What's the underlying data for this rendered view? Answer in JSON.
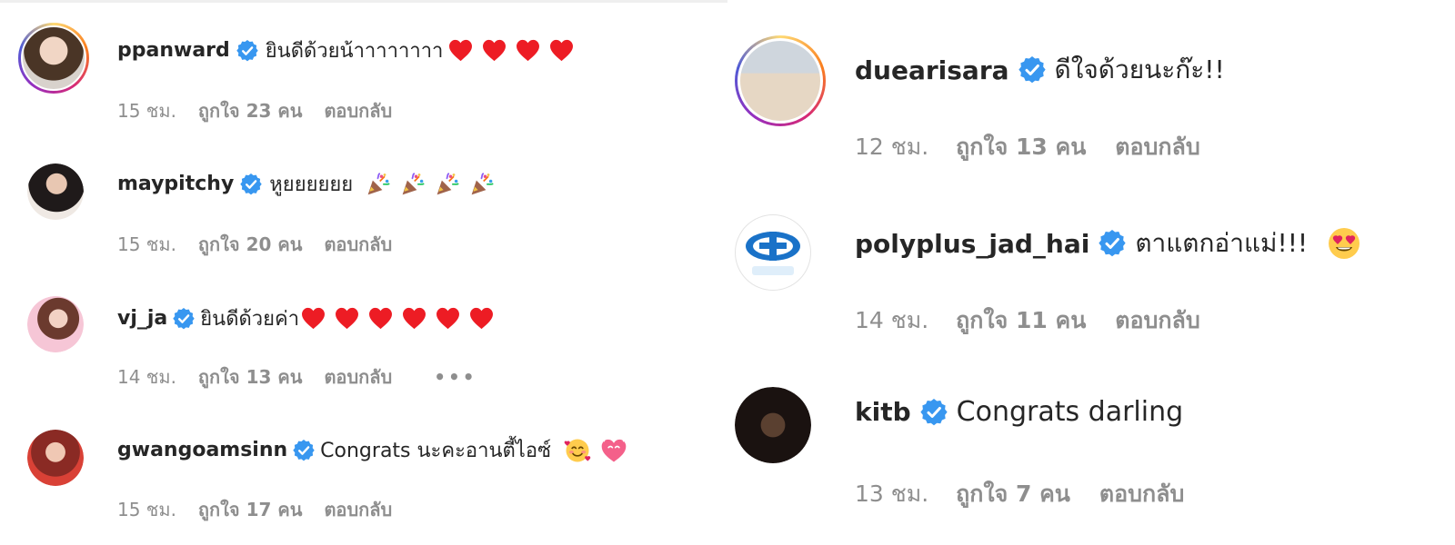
{
  "left": {
    "comments": [
      {
        "username": "ppanward",
        "text": "ยินดีด้วยน้าาาาาาาา",
        "emojis": [
          "heart",
          "heart",
          "heart",
          "heart"
        ],
        "time": "15 ชม.",
        "likes": "ถูกใจ 23 คน",
        "reply": "ตอบกลับ"
      },
      {
        "username": "maypitchy",
        "text": "หูยยยยยย",
        "emojis": [
          "party",
          "party",
          "party",
          "party"
        ],
        "time": "15 ชม.",
        "likes": "ถูกใจ 20 คน",
        "reply": "ตอบกลับ"
      },
      {
        "username": "vj_ja",
        "text": "ยินดีด้วยค่า",
        "emojis": [
          "heart",
          "heart",
          "heart",
          "heart",
          "heart",
          "heart"
        ],
        "time": "14 ชม.",
        "likes": "ถูกใจ 13 คน",
        "reply": "ตอบกลับ",
        "more": "•••"
      },
      {
        "username": "gwangoamsinn",
        "text": "Congrats นะคะอานตี้ไอซ์",
        "emojis": [
          "smiling-hearts",
          "heart-eyes-pink"
        ],
        "time": "15 ชม.",
        "likes": "ถูกใจ 17 คน",
        "reply": "ตอบกลับ"
      }
    ]
  },
  "right": {
    "comments": [
      {
        "username": "duearisara",
        "text": "ดีใจด้วยนะก๊ะ!!",
        "emojis": [],
        "time": "12 ชม.",
        "likes": "ถูกใจ 13 คน",
        "reply": "ตอบกลับ"
      },
      {
        "username": "polyplus_jad_hai",
        "text": "ตาแตกอ่าแม่!!!",
        "emojis": [
          "heart-eyes"
        ],
        "time": "14 ชม.",
        "likes": "ถูกใจ 11 คน",
        "reply": "ตอบกลับ"
      },
      {
        "username": "kitb",
        "text": "Congrats darling",
        "emojis": [],
        "time": "13 ชม.",
        "likes": "ถูกใจ 7 คน",
        "reply": "ตอบกลับ"
      }
    ]
  },
  "colors": {
    "verified": "#3897f0",
    "meta": "#8e8e8e",
    "text": "#262626",
    "heart": "#ed1c24"
  }
}
